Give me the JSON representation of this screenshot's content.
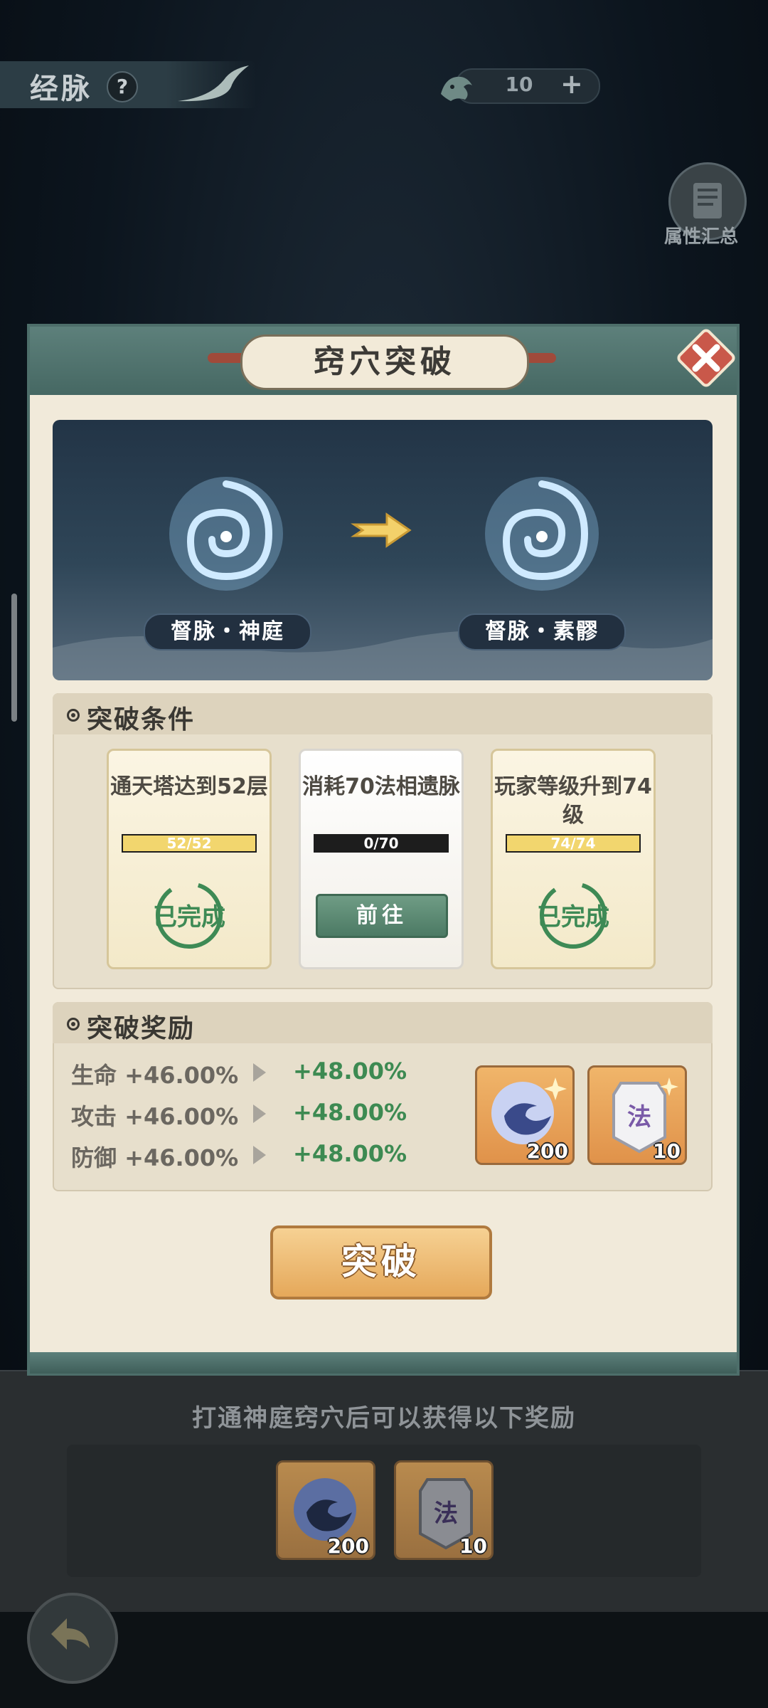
{
  "header": {
    "title": "经脉",
    "help_icon": "question-icon",
    "currency_value": "10",
    "currency_plus": "+"
  },
  "side": {
    "summary_label": "属性汇总"
  },
  "modal": {
    "title": "窍穴突破",
    "from_node": "督脉・神庭",
    "to_node": "督脉・素髎",
    "conditions": {
      "heading": "突破条件",
      "cards": [
        {
          "text": "通天塔达到52层",
          "progress_text": "52/52",
          "progress": 1.0,
          "status": "已完成"
        },
        {
          "text": "消耗70法相遗脉",
          "progress_text": "0/70",
          "progress": 0.0,
          "button": "前往"
        },
        {
          "text": "玩家等级升到74级",
          "progress_text": "74/74",
          "progress": 1.0,
          "status": "已完成"
        }
      ]
    },
    "rewards": {
      "heading": "突破奖励",
      "stats": [
        {
          "label": "生命 +46.00%",
          "new": "+48.00%"
        },
        {
          "label": "攻击 +46.00%",
          "new": "+48.00%"
        },
        {
          "label": "防御 +46.00%",
          "new": "+48.00%"
        }
      ],
      "items": [
        {
          "icon": "spirit-orb-icon",
          "count": "200"
        },
        {
          "icon": "law-token-icon",
          "token_text": "法",
          "count": "10"
        }
      ]
    },
    "break_button": "突破"
  },
  "bottom": {
    "text": "打通神庭窍穴后可以获得以下奖励",
    "items": [
      {
        "icon": "spirit-orb-icon",
        "count": "200"
      },
      {
        "icon": "law-token-icon",
        "token_text": "法",
        "count": "10"
      }
    ]
  },
  "colors": {
    "accent_green": "#3d8a52",
    "panel_bg": "#f1eada",
    "frame": "#4d6e6a",
    "button_gold": "#e5a85a"
  }
}
